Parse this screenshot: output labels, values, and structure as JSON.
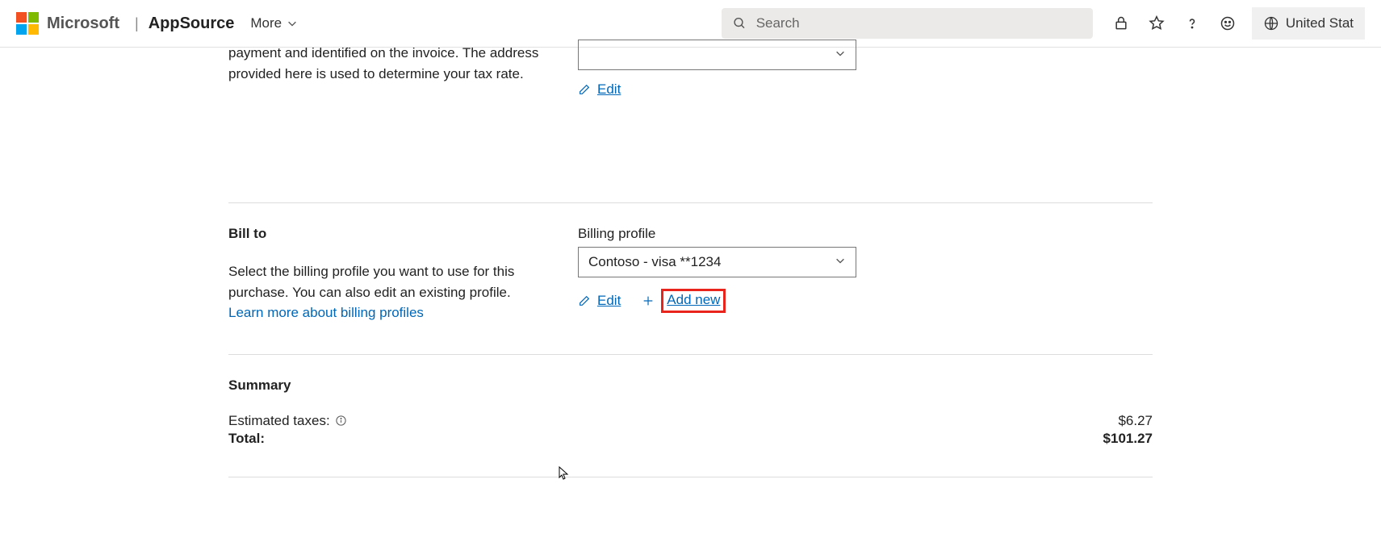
{
  "header": {
    "microsoft": "Microsoft",
    "appsource": "AppSource",
    "more": "More",
    "search_placeholder": "Search",
    "region": "United Stat"
  },
  "sold_to": {
    "desc_visible": "payment and identified on the invoice. The address provided here is used to determine your tax rate.",
    "select_value": "",
    "edit_label": "Edit"
  },
  "bill_to": {
    "title": "Bill to",
    "desc": "Select the billing profile you want to use for this purchase. You can also edit an existing profile. ",
    "learn_more": "Learn more about billing profiles",
    "field_label": "Billing profile",
    "select_value": "Contoso - visa **1234",
    "edit_label": "Edit",
    "add_new_label": "Add new"
  },
  "summary": {
    "title": "Summary",
    "rows": [
      {
        "label": "Estimated taxes:",
        "value": "$6.27",
        "info": true
      },
      {
        "label": "Total:",
        "value": "$101.27",
        "bold": true
      }
    ]
  }
}
